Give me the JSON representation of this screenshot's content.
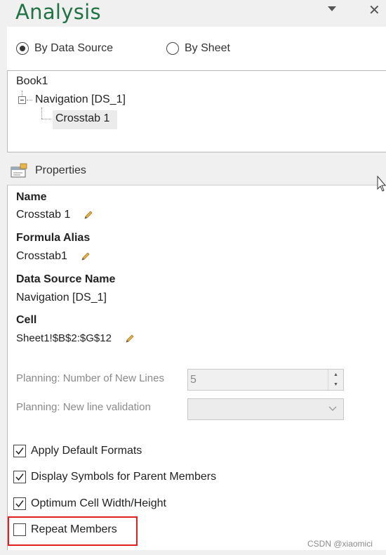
{
  "pane": {
    "title": "Analysis"
  },
  "view_mode": {
    "options": [
      {
        "label": "By Data Source",
        "selected": true
      },
      {
        "label": "By Sheet",
        "selected": false
      }
    ]
  },
  "tree": {
    "root": "Book1",
    "child": "Navigation [DS_1]",
    "grandchild": "Crosstab 1"
  },
  "properties": {
    "header": "Properties",
    "fields": [
      {
        "title": "Name",
        "value": "Crosstab 1",
        "editable": true
      },
      {
        "title": "Formula Alias",
        "value": "Crosstab1",
        "editable": true
      },
      {
        "title": "Data Source Name",
        "value": "Navigation [DS_1]",
        "editable": false
      },
      {
        "title": "Cell",
        "value": "Sheet1!$B$2:$G$12",
        "editable": true
      }
    ],
    "planning": {
      "new_lines_label": "Planning: Number of New Lines",
      "new_lines_value": "5",
      "validation_label": "Planning: New line validation",
      "validation_value": ""
    },
    "checkboxes": [
      {
        "label": "Apply Default Formats",
        "checked": true
      },
      {
        "label": "Display Symbols for Parent Members",
        "checked": true
      },
      {
        "label": "Optimum Cell Width/Height",
        "checked": true
      },
      {
        "label": "Repeat Members",
        "checked": false
      }
    ]
  },
  "watermark": "CSDN @xiaomici",
  "colors": {
    "title": "#217346",
    "highlight": "#e02020"
  }
}
